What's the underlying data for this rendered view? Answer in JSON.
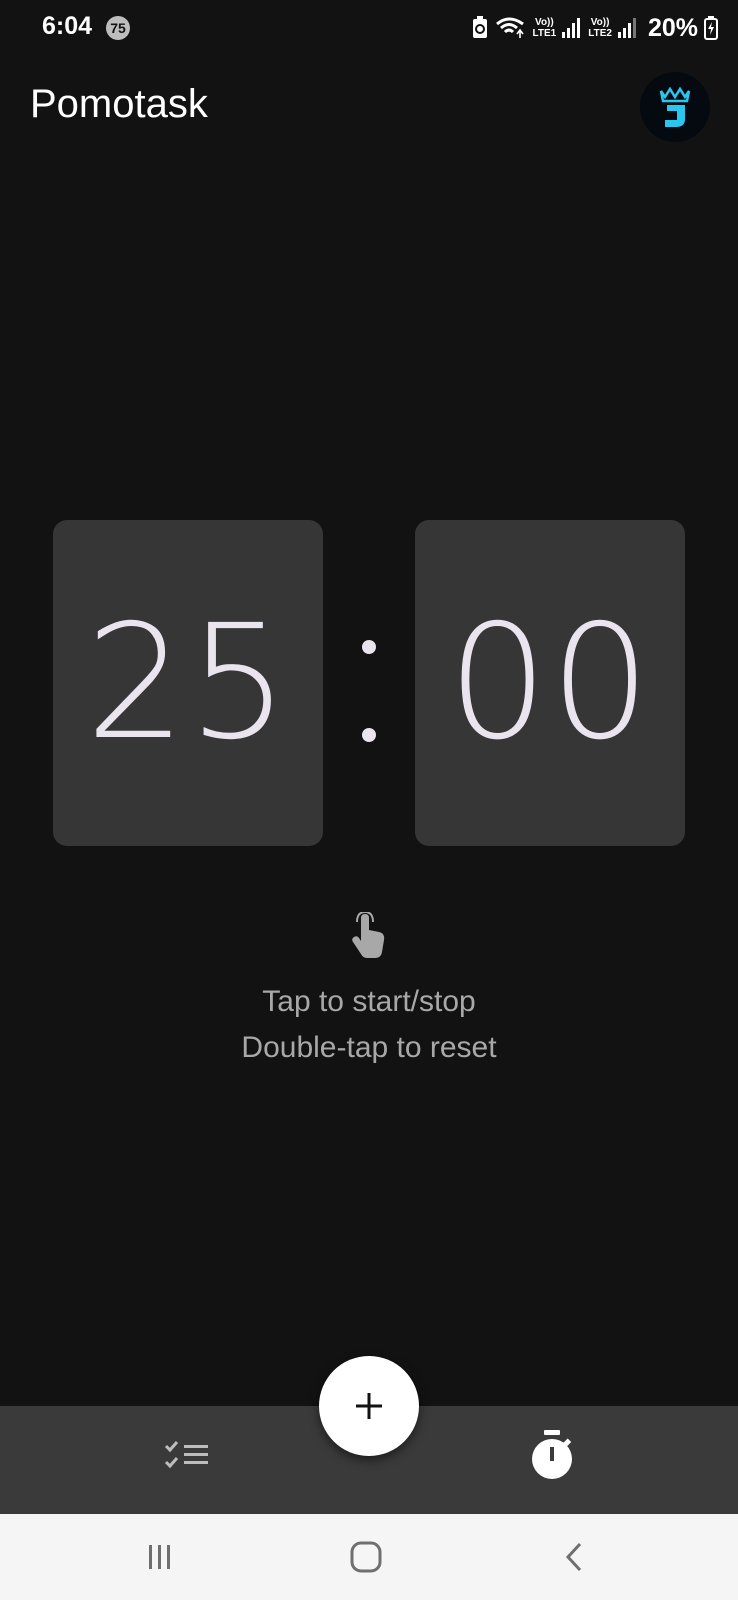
{
  "status_bar": {
    "time": "6:04",
    "notification_count": "75",
    "sim1_label_top": "Vo))",
    "sim1_label_bottom": "LTE1",
    "sim2_label_top": "Vo))",
    "sim2_label_bottom": "LTE2",
    "battery": "20%"
  },
  "app_bar": {
    "title": "Pomotask",
    "avatar_letter": "J",
    "avatar_color": "#29c6f0"
  },
  "timer": {
    "minutes": "25",
    "seconds": "00"
  },
  "hint": {
    "icon": "touch-app-icon",
    "line1": "Tap to start/stop",
    "line2": "Double-tap to reset"
  },
  "bottom_nav": {
    "items": [
      {
        "icon": "checklist-icon"
      },
      {
        "icon": "stopwatch-icon"
      }
    ],
    "fab_icon": "plus-icon"
  },
  "system_nav": {
    "recents_icon": "recents-icon",
    "home_icon": "home-icon",
    "back_icon": "back-icon"
  },
  "colors": {
    "background": "#121212",
    "card": "#363636",
    "digits": "#e9e4ee",
    "bottom_bar": "#3a3a3a",
    "fab": "#ffffff"
  }
}
